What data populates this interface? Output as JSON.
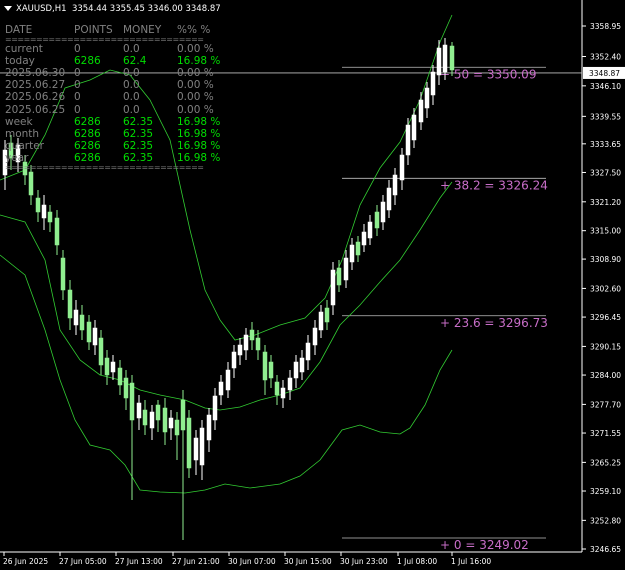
{
  "header": {
    "symbol": "XAUUSD,H1",
    "ohlc": "3354.44 3355.45 3346.00 3348.87"
  },
  "stats": {
    "columns": [
      "DATE",
      "POINTS",
      "MONEY",
      "%%",
      "%"
    ],
    "separator": "================================",
    "rows": [
      {
        "label": "current",
        "points": "0",
        "money": "0.0",
        "pct": "0.00",
        "unit": "%",
        "color": "grey"
      },
      {
        "label": "today",
        "points": "6286",
        "money": "62.4",
        "pct": "16.98",
        "unit": "%",
        "color": "green"
      },
      {
        "label": "2025.06.30",
        "points": "0",
        "money": "0.0",
        "pct": "0.00",
        "unit": "%",
        "color": "grey"
      },
      {
        "label": "2025.06.27",
        "points": "0",
        "money": "0.0",
        "pct": "0.00",
        "unit": "%",
        "color": "grey"
      },
      {
        "label": "2025.06.26",
        "points": "0",
        "money": "0.0",
        "pct": "0.00",
        "unit": "%",
        "color": "grey"
      },
      {
        "label": "2025.06.25",
        "points": "0",
        "money": "0.0",
        "pct": "0.00",
        "unit": "%",
        "color": "grey"
      },
      {
        "label": "week",
        "points": "6286",
        "money": "62.35",
        "pct": "16.98",
        "unit": "%",
        "color": "green"
      },
      {
        "label": "month",
        "points": "6286",
        "money": "62.35",
        "pct": "16.98",
        "unit": "%",
        "color": "green"
      },
      {
        "label": "quarter",
        "points": "6286",
        "money": "62.35",
        "pct": "16.98",
        "unit": "%",
        "color": "green"
      },
      {
        "label": "year",
        "points": "6286",
        "money": "62.35",
        "pct": "16.98",
        "unit": "%",
        "color": "green"
      }
    ]
  },
  "price_axis": {
    "ticks": [
      "3358.95",
      "3352.40",
      "3346.10",
      "3339.55",
      "3333.65",
      "3327.50",
      "3321.20",
      "3315.00",
      "3308.90",
      "3302.60",
      "3296.45",
      "3290.15",
      "3284.00",
      "3277.70",
      "3271.55",
      "3265.25",
      "3259.10",
      "3252.80",
      "3246.65"
    ],
    "current_price": "3348.87"
  },
  "time_axis": {
    "labels": [
      "26 Jun 2025",
      "27 Jun 05:00",
      "27 Jun 13:00",
      "27 Jun 21:00",
      "30 Jun 07:00",
      "30 Jun 15:00",
      "30 Jun 23:00",
      "1 Jul 08:00",
      "1 Jul 16:00"
    ]
  },
  "fibonacci": [
    {
      "level": "50",
      "price": "3350.09",
      "text": "50  = 3350.09"
    },
    {
      "level": "38.2",
      "price": "3326.24",
      "text": "38.2  = 3326.24"
    },
    {
      "level": "23.6",
      "price": "3296.73",
      "text": "23.6  = 3296.73"
    },
    {
      "level": "0",
      "price": "3249.02",
      "text": "0  = 3249.02"
    }
  ],
  "colors": {
    "background": "#000000",
    "candle_bull": "#ffffff",
    "candle_bear": "#90ee90",
    "bands": "#32cd32",
    "fib_label": "#c86ec8",
    "grid_line": "#c0c0c0"
  }
}
